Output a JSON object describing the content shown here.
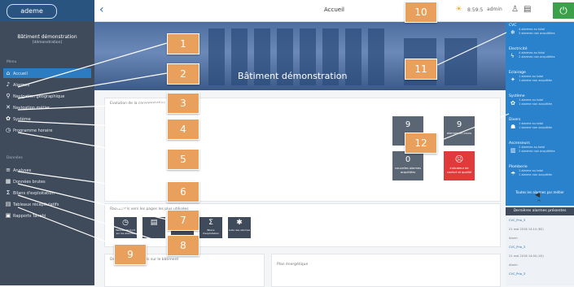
{
  "app": {
    "logo_text": "ademe"
  },
  "sidebar": {
    "site_name": "Bâtiment démonstration",
    "site_sub": "[démonstration]",
    "menu_label": "Menu",
    "menu_items": [
      {
        "icon": "home-icon",
        "glyph": "⌂",
        "label": "Accueil",
        "active": true
      },
      {
        "icon": "bell-icon",
        "glyph": "♪",
        "label": "Alarmes",
        "active": false
      },
      {
        "icon": "geo-nav-icon",
        "glyph": "⚲",
        "label": "Navigation géographique",
        "active": false
      },
      {
        "icon": "tools-icon",
        "glyph": "✕",
        "label": "Navigation métier",
        "active": false
      },
      {
        "icon": "system-icon",
        "glyph": "✿",
        "label": "Système",
        "active": false
      },
      {
        "icon": "clock-icon",
        "glyph": "◷",
        "label": "Programme horaire",
        "active": false
      }
    ],
    "extra_label": "Données",
    "extra_items": [
      {
        "icon": "chart-icon",
        "glyph": "≡",
        "label": "Analyses"
      },
      {
        "icon": "chart2-icon",
        "glyph": "▦",
        "label": "Données brutes"
      },
      {
        "icon": "sum-icon",
        "glyph": "Σ",
        "label": "Bilans d'exploitation"
      },
      {
        "icon": "grid-icon",
        "glyph": "▤",
        "label": "Tableaux récapitulatifs"
      },
      {
        "icon": "report-icon",
        "glyph": "▣",
        "label": "Rapports Tanebi"
      }
    ]
  },
  "topbar": {
    "title": "Accueil",
    "user": "admin",
    "time": "8:59:5"
  },
  "banner": {
    "title": "Bâtiment démonstration"
  },
  "panel_main": {
    "head": "Evolution de la consommation"
  },
  "tiles": [
    {
      "value": "9",
      "label": "",
      "color": "#5b6675"
    },
    {
      "value": "9",
      "label": "alarmes en cours",
      "color": "#5b6675"
    },
    {
      "value": "0",
      "label": "nouvelles alarmes acquittées",
      "color": "#5b6675"
    },
    {
      "value": "☹",
      "label": "indicateur de confort et qualité",
      "color": "#e03a3a"
    }
  ],
  "quicklinks": {
    "head": "Raccourcis vers les pages les plus utilisées",
    "items": [
      {
        "glyph": "◷",
        "label": "Tableau de bord sur les alarmes"
      },
      {
        "glyph": "▤",
        "label": ""
      },
      {
        "glyph": "▦",
        "label": ""
      },
      {
        "glyph": "Σ",
        "label": "Bilans d'exploitation"
      },
      {
        "glyph": "✱",
        "label": "Liste des alarmes"
      }
    ]
  },
  "bottom_left": {
    "title": "Derniers événements sur le bâtiment"
  },
  "bottom_mid": {
    "title": "Plan énergétique"
  },
  "right_panel": {
    "categories": [
      {
        "name": "CVC",
        "icon": "hvac-icon",
        "glyph": "❄",
        "d1": "4 alarmes au total",
        "d2": "2 alarmes non acquittées"
      },
      {
        "name": "Electricité",
        "icon": "electric-icon",
        "glyph": "ϟ",
        "d1": "4 alarmes au total",
        "d2": "2 alarmes non acquittées"
      },
      {
        "name": "Eclairage",
        "icon": "bulb-icon",
        "glyph": "✦",
        "d1": "1 alarme au total",
        "d2": "1 alarme non acquittée"
      },
      {
        "name": "Système",
        "icon": "system2-icon",
        "glyph": "✿",
        "d1": "1 alarme au total",
        "d2": "1 alarme non acquittée"
      },
      {
        "name": "Divers",
        "icon": "misc-icon",
        "glyph": "☗",
        "d1": "1 alarme au total",
        "d2": "1 alarme non acquittée"
      },
      {
        "name": "Ascenseurs",
        "icon": "lift-icon",
        "glyph": "▥",
        "d1": "2 alarmes au total",
        "d2": "2 alarmes non acquittées"
      },
      {
        "name": "Plomberie",
        "icon": "plumb-icon",
        "glyph": "☂",
        "d1": "1 alarme au total",
        "d2": "1 alarme non acquittée"
      }
    ],
    "all_alarms": "Toutes les alarmes par métier",
    "latest_title": "Dernières alarmes présentes",
    "latest": [
      {
        "txt": "CVC_Prio_3",
        "dim": false
      },
      {
        "txt": "21 mai 2018 14:14 (62)",
        "dim": true
      },
      {
        "txt": "Alarm",
        "dim": true
      },
      {
        "txt": "CVC_Prio_3",
        "dim": false
      },
      {
        "txt": "21 mai 2018 14:04 (43)",
        "dim": true
      },
      {
        "txt": "Alarm",
        "dim": true
      },
      {
        "txt": "CVC_Prio_3",
        "dim": false
      }
    ]
  },
  "callouts": [
    "1",
    "2",
    "3",
    "4",
    "5",
    "6",
    "7",
    "8",
    "9",
    "10",
    "11",
    "12"
  ],
  "colors": {
    "accent": "#2b82cc",
    "sidebar": "#3f4a5a",
    "callout": "#e9a05c",
    "power": "#3aa04a"
  }
}
